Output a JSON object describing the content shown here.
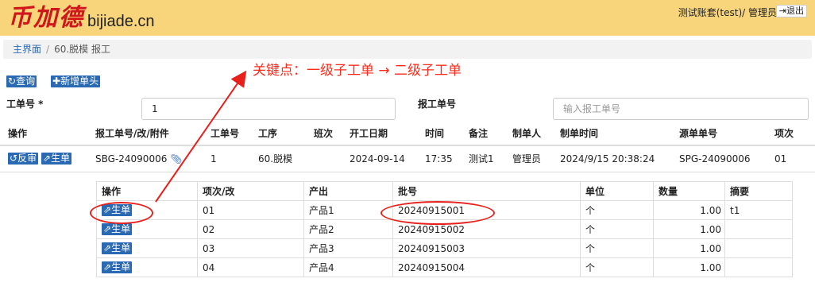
{
  "header": {
    "logo_cn": "币加德",
    "logo_en": "bijiade.cn",
    "user": "测试账套(test)/ 管理员",
    "logout": "退出"
  },
  "breadcrumb": {
    "home": "主界面",
    "sep": "/",
    "current": "60.脱模 报工"
  },
  "annotation": "关键点：一级子工单 → 二级子工单",
  "toolbar": {
    "query": "查询",
    "add": "新增单头"
  },
  "form": {
    "work_order_label": "工单号 *",
    "work_order_value": "1",
    "report_label": "报工单号",
    "report_placeholder": "输入报工单号"
  },
  "main_table": {
    "headers": [
      "操作",
      "报工单号/改/附件",
      "工单号",
      "工序",
      "班次",
      "开工日期",
      "时间",
      "备注",
      "制单人",
      "制单时间",
      "源单单号",
      "项次"
    ],
    "actions": [
      "反审",
      "生单"
    ],
    "row": [
      "SBG-24090006",
      "1",
      "60.脱模",
      "",
      "2024-09-14",
      "17:35",
      "测试1",
      "管理员",
      "2024/9/15 20:38:24",
      "SPG-24090006",
      "01"
    ]
  },
  "sub_table": {
    "headers": [
      "操作",
      "项次/改",
      "产出",
      "批号",
      "单位",
      "数量",
      "摘要"
    ],
    "action": "生单",
    "rows": [
      [
        "01",
        "产品1",
        "20240915001",
        "个",
        "1.00",
        "t1"
      ],
      [
        "02",
        "产品2",
        "20240915002",
        "个",
        "1.00",
        ""
      ],
      [
        "03",
        "产品3",
        "20240915003",
        "个",
        "1.00",
        ""
      ],
      [
        "04",
        "产品4",
        "20240915004",
        "个",
        "1.00",
        ""
      ]
    ]
  },
  "colors": {
    "header_bg": "#f8d57b",
    "primary": "#2a6ab4",
    "annotation": "#ff2a1a"
  }
}
